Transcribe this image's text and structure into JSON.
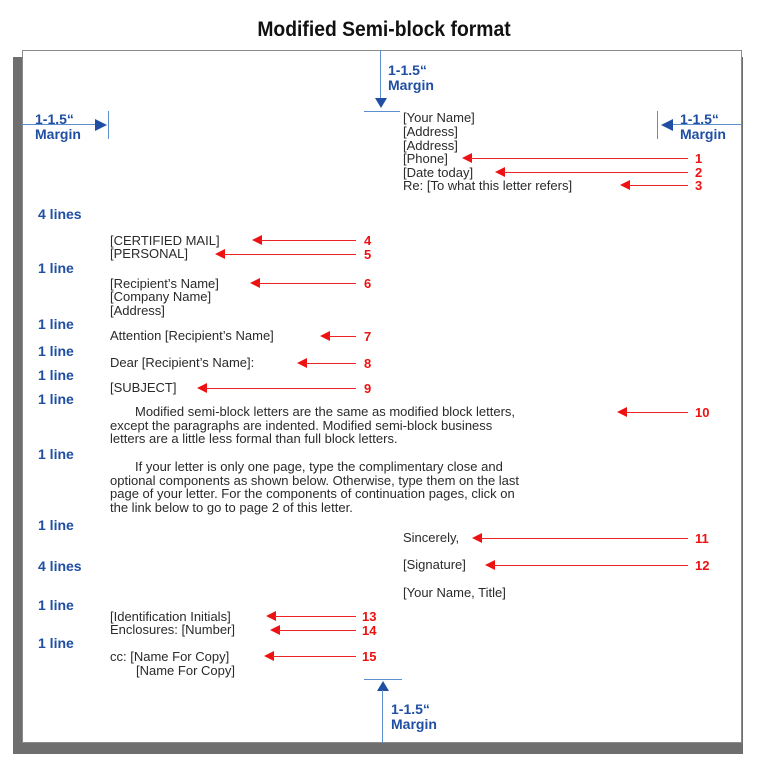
{
  "title": "Modified Semi-block format",
  "margins": {
    "top": {
      "value": "1-1.5“",
      "label": "Margin"
    },
    "left": {
      "value": "1-1.5“",
      "label": "Margin"
    },
    "right": {
      "value": "1-1.5“",
      "label": "Margin"
    },
    "bottom": {
      "value": "1-1.5“",
      "label": "Margin"
    }
  },
  "spacing_labels": [
    "4 lines",
    "1 line",
    "1 line",
    "1 line",
    "1 line",
    "1 line",
    "1 line",
    "1 line",
    "4 lines",
    "1 line",
    "1 line"
  ],
  "sender_block": [
    "[Your Name]",
    "[Address]",
    "[Address]",
    "[Phone]",
    "[Date today]",
    "Re: [To what this letter refers]"
  ],
  "notations": [
    "[CERTIFIED MAIL]",
    "[PERSONAL]"
  ],
  "recipient_block": [
    "[Recipient’s Name]",
    "[Company Name]",
    "[Address]"
  ],
  "attention": "Attention [Recipient’s Name]",
  "salutation": "Dear [Recipient’s Name]:",
  "subject": "[SUBJECT]",
  "paragraphs": [
    [
      "Modified semi-block letters are the same as modified block letters,",
      "except the paragraphs are indented.  Modified semi-block business",
      "letters are a little less formal than full block letters."
    ],
    [
      "If your letter is only one page, type the complimentary close and",
      "optional components as shown below.  Otherwise, type them on the last",
      "page of your letter.  For the components of continuation pages, click on",
      "the link below to go to page 2 of this letter."
    ]
  ],
  "closing": "Sincerely,",
  "signature": "[Signature]",
  "name_title": "[Your Name, Title]",
  "identification": "[Identification Initials]",
  "enclosures": "Enclosures: [Number]",
  "cc": [
    "cc: [Name For Copy]",
    "[Name For Copy]"
  ],
  "callouts": [
    "1",
    "2",
    "3",
    "4",
    "5",
    "6",
    "7",
    "8",
    "9",
    "10",
    "11",
    "12",
    "13",
    "14",
    "15"
  ],
  "colors": {
    "annotation_blue": "#1f4ea3",
    "callout_red": "#ee1111"
  }
}
